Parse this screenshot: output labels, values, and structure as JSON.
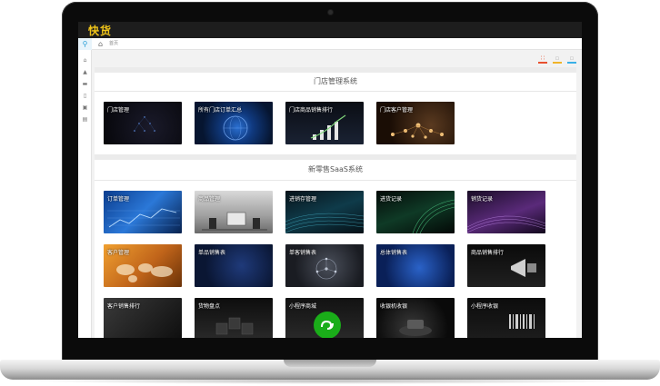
{
  "app": {
    "logo": "快货"
  },
  "breadcrumb": {
    "current": "首页"
  },
  "sidebar": {
    "icons": [
      "search-icon",
      "home-icon",
      "org-icon",
      "list-icon",
      "phone-icon",
      "cart-icon",
      "report-icon"
    ]
  },
  "toolbar": {
    "icons": [
      "fullscreen-icon",
      "refresh-icon",
      "settings-icon"
    ]
  },
  "sections": [
    {
      "title": "门店管理系统",
      "tiles": [
        {
          "label": "门店管理"
        },
        {
          "label": "所有门店订单汇总"
        },
        {
          "label": "门店商品销售排行"
        },
        {
          "label": "门店客户管理"
        }
      ]
    },
    {
      "title": "新零售SaaS系统",
      "tiles": [
        {
          "label": "订单管理"
        },
        {
          "label": "商品管理"
        },
        {
          "label": "进销存管理"
        },
        {
          "label": "进货记录"
        },
        {
          "label": "销货记录"
        },
        {
          "label": "客户管理"
        },
        {
          "label": "单品销售表"
        },
        {
          "label": "单客销售表"
        },
        {
          "label": "总体销售表"
        },
        {
          "label": "商品销售排行"
        },
        {
          "label": "客户销售排行"
        },
        {
          "label": "货物盘点"
        },
        {
          "label": "小程序商城"
        },
        {
          "label": "收银机收银"
        },
        {
          "label": "小程序收银"
        }
      ]
    }
  ]
}
